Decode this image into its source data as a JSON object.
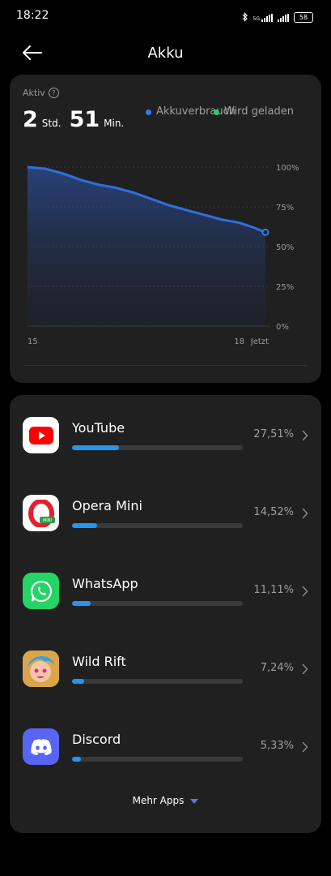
{
  "status_bar": {
    "time": "18:22",
    "network": "5G",
    "battery": "58"
  },
  "header": {
    "title": "Akku"
  },
  "usage": {
    "active_label": "Aktiv",
    "hours": "2",
    "hours_unit": "Std.",
    "minutes": "51",
    "minutes_unit": "Min.",
    "legend": {
      "usage": "Akkuverbrauch",
      "charging": "Wird geladen"
    }
  },
  "chart_data": {
    "type": "area",
    "x": [
      15.0,
      15.25,
      15.5,
      15.75,
      16.0,
      16.25,
      16.5,
      16.75,
      17.0,
      17.25,
      17.5,
      17.75,
      18.0,
      18.2,
      18.37
    ],
    "values": [
      100,
      99,
      96,
      92,
      89,
      87,
      84,
      80,
      76,
      73,
      70,
      67,
      65,
      62,
      59
    ],
    "series": [
      {
        "name": "Akkuverbrauch",
        "color": "#2f6fe0"
      }
    ],
    "x_tick_labels": [
      "15",
      "18",
      "Jetzt"
    ],
    "y_tick_labels": [
      "100%",
      "75%",
      "50%",
      "25%",
      "0%"
    ],
    "ylim": [
      0,
      100
    ],
    "grid": true
  },
  "apps": [
    {
      "name": "YouTube",
      "percent_text": "27,51%",
      "percent": 27.51,
      "icon": "youtube-icon"
    },
    {
      "name": "Opera Mini",
      "percent_text": "14,52%",
      "percent": 14.52,
      "icon": "opera-mini-icon"
    },
    {
      "name": "WhatsApp",
      "percent_text": "11,11%",
      "percent": 11.11,
      "icon": "whatsapp-icon"
    },
    {
      "name": "Wild Rift",
      "percent_text": "7,24%",
      "percent": 7.24,
      "icon": "wild-rift-icon"
    },
    {
      "name": "Discord",
      "percent_text": "5,33%",
      "percent": 5.33,
      "icon": "discord-icon"
    }
  ],
  "more_apps_label": "Mehr Apps",
  "colors": {
    "accent": "#2196f3",
    "usage_dot": "#2f7df0",
    "charging_dot": "#2ecc71",
    "card_bg": "#202020"
  }
}
